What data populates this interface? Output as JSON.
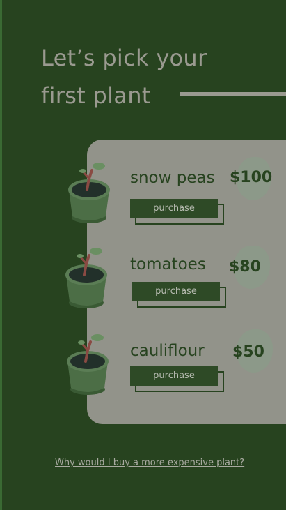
{
  "header": {
    "title_line1": "Let’s pick your",
    "title_line2": "first plant"
  },
  "plants": [
    {
      "name": "snow peas",
      "price": "$100",
      "button_label": "purchase"
    },
    {
      "name": "tomatoes",
      "price": "$80",
      "button_label": "purchase"
    },
    {
      "name": "cauliflour",
      "price": "$50",
      "button_label": "purchase"
    }
  ],
  "footer": {
    "link_text": "Why would I buy a more expensive plant?"
  },
  "colors": {
    "background": "#27431f",
    "card": "#92938a",
    "accent": "#2e4a26",
    "text_light": "#9a9a90"
  },
  "icons": [
    "potted-plant-icon"
  ]
}
